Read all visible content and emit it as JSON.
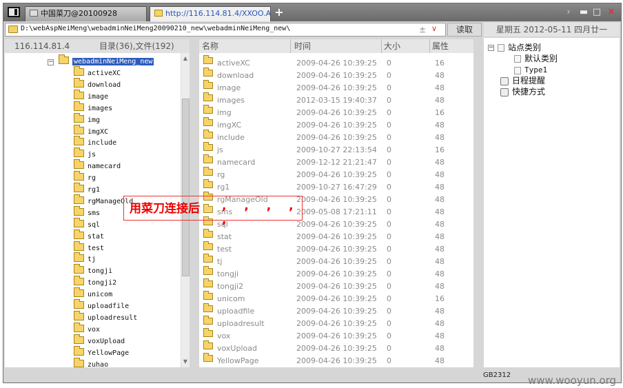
{
  "tabs": [
    {
      "label": "中国菜刀@20100928"
    },
    {
      "label": "http://116.114.81.4/XXOO.A..."
    }
  ],
  "toolbar": {
    "path": "D:\\webAspNeiMeng\\webadminNeiMeng20090210_new\\webadminNeiMeng_new\\",
    "read_label": "读取",
    "date": "星期五 2012-05-11 四月廿一"
  },
  "left": {
    "ip": "116.114.81.4",
    "counts": "目录(36),文件(192)",
    "root": "webadminNeiMeng_new",
    "items": [
      "activeXC",
      "download",
      "image",
      "images",
      "img",
      "imgXC",
      "include",
      "js",
      "namecard",
      "rg",
      "rg1",
      "rgManageOld",
      "sms",
      "sql",
      "stat",
      "test",
      "tj",
      "tongji",
      "tongji2",
      "unicom",
      "uploadfile",
      "uploadresult",
      "vox",
      "voxUpload",
      "YellowPage",
      "zuhao"
    ]
  },
  "list": {
    "headers": {
      "name": "名称",
      "time": "时间",
      "size": "大小",
      "attr": "属性"
    },
    "rows": [
      {
        "name": "activeXC",
        "time": "2009-04-26 10:39:25",
        "size": "0",
        "attr": "16"
      },
      {
        "name": "download",
        "time": "2009-04-26 10:39:25",
        "size": "0",
        "attr": "48"
      },
      {
        "name": "image",
        "time": "2009-04-26 10:39:25",
        "size": "0",
        "attr": "48"
      },
      {
        "name": "images",
        "time": "2012-03-15 19:40:37",
        "size": "0",
        "attr": "48"
      },
      {
        "name": "img",
        "time": "2009-04-26 10:39:25",
        "size": "0",
        "attr": "16"
      },
      {
        "name": "imgXC",
        "time": "2009-04-26 10:39:25",
        "size": "0",
        "attr": "48"
      },
      {
        "name": "include",
        "time": "2009-04-26 10:39:25",
        "size": "0",
        "attr": "48"
      },
      {
        "name": "js",
        "time": "2009-10-27 22:13:54",
        "size": "0",
        "attr": "16"
      },
      {
        "name": "namecard",
        "time": "2009-12-12 21:21:47",
        "size": "0",
        "attr": "48"
      },
      {
        "name": "rg",
        "time": "2009-04-26 10:39:25",
        "size": "0",
        "attr": "48"
      },
      {
        "name": "rg1",
        "time": "2009-10-27 16:47:29",
        "size": "0",
        "attr": "48"
      },
      {
        "name": "rgManageOld",
        "time": "2009-04-26 10:39:25",
        "size": "0",
        "attr": "48"
      },
      {
        "name": "sms",
        "time": "2009-05-08 17:21:11",
        "size": "0",
        "attr": "48"
      },
      {
        "name": "sql",
        "time": "2009-04-26 10:39:25",
        "size": "0",
        "attr": "48"
      },
      {
        "name": "stat",
        "time": "2009-04-26 10:39:25",
        "size": "0",
        "attr": "48"
      },
      {
        "name": "test",
        "time": "2009-04-26 10:39:25",
        "size": "0",
        "attr": "48"
      },
      {
        "name": "tj",
        "time": "2009-04-26 10:39:25",
        "size": "0",
        "attr": "48"
      },
      {
        "name": "tongji",
        "time": "2009-04-26 10:39:25",
        "size": "0",
        "attr": "48"
      },
      {
        "name": "tongji2",
        "time": "2009-04-26 10:39:25",
        "size": "0",
        "attr": "48"
      },
      {
        "name": "unicom",
        "time": "2009-04-26 10:39:25",
        "size": "0",
        "attr": "16"
      },
      {
        "name": "uploadfile",
        "time": "2009-04-26 10:39:25",
        "size": "0",
        "attr": "48"
      },
      {
        "name": "uploadresult",
        "time": "2009-04-26 10:39:25",
        "size": "0",
        "attr": "48"
      },
      {
        "name": "vox",
        "time": "2009-04-26 10:39:25",
        "size": "0",
        "attr": "48"
      },
      {
        "name": "voxUpload",
        "time": "2009-04-26 10:39:25",
        "size": "0",
        "attr": "48"
      },
      {
        "name": "YellowPage",
        "time": "2009-04-26 10:39:25",
        "size": "0",
        "attr": "48"
      }
    ]
  },
  "right": {
    "root": "站点类别",
    "children": [
      "默认类别",
      "Type1"
    ],
    "schedule": "日程提醒",
    "shortcut": "快捷方式"
  },
  "status": {
    "encoding": "GB2312"
  },
  "annotation": {
    "text": "用菜刀连接后",
    "dots": ", , , , ,"
  },
  "watermark": "www.wooyun.org"
}
